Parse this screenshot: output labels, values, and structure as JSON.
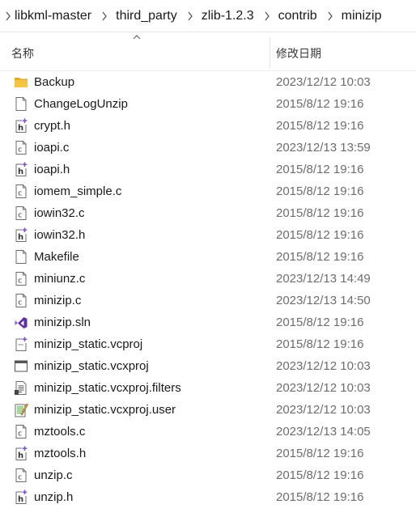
{
  "breadcrumb": [
    "libkml-master",
    "third_party",
    "zlib-1.2.3",
    "contrib",
    "minizip"
  ],
  "header": {
    "name_label": "名称",
    "date_label": "修改日期"
  },
  "files": [
    {
      "name": "Backup",
      "date": "2023/12/12 10:03",
      "icon": "folder-icon"
    },
    {
      "name": "ChangeLogUnzip",
      "date": "2015/8/12 19:16",
      "icon": "file-icon"
    },
    {
      "name": "crypt.h",
      "date": "2015/8/12 19:16",
      "icon": "header-file-icon"
    },
    {
      "name": "ioapi.c",
      "date": "2023/12/13 13:59",
      "icon": "c-file-icon"
    },
    {
      "name": "ioapi.h",
      "date": "2015/8/12 19:16",
      "icon": "header-file-icon"
    },
    {
      "name": "iomem_simple.c",
      "date": "2015/8/12 19:16",
      "icon": "c-file-icon"
    },
    {
      "name": "iowin32.c",
      "date": "2015/8/12 19:16",
      "icon": "c-file-icon"
    },
    {
      "name": "iowin32.h",
      "date": "2015/8/12 19:16",
      "icon": "header-file-icon"
    },
    {
      "name": "Makefile",
      "date": "2015/8/12 19:16",
      "icon": "file-icon"
    },
    {
      "name": "miniunz.c",
      "date": "2023/12/13 14:49",
      "icon": "c-file-icon"
    },
    {
      "name": "minizip.c",
      "date": "2023/12/13 14:50",
      "icon": "c-file-icon"
    },
    {
      "name": "minizip.sln",
      "date": "2015/8/12 19:16",
      "icon": "vs-solution-icon"
    },
    {
      "name": "minizip_static.vcproj",
      "date": "2015/8/12 19:16",
      "icon": "vcproj-icon"
    },
    {
      "name": "minizip_static.vcxproj",
      "date": "2023/12/12 10:03",
      "icon": "vcxproj-icon"
    },
    {
      "name": "minizip_static.vcxproj.filters",
      "date": "2023/12/12 10:03",
      "icon": "filters-file-icon"
    },
    {
      "name": "minizip_static.vcxproj.user",
      "date": "2023/12/12 10:03",
      "icon": "user-file-icon"
    },
    {
      "name": "mztools.c",
      "date": "2023/12/13 14:05",
      "icon": "c-file-icon"
    },
    {
      "name": "mztools.h",
      "date": "2015/8/12 19:16",
      "icon": "header-file-icon"
    },
    {
      "name": "unzip.c",
      "date": "2015/8/12 19:16",
      "icon": "c-file-icon"
    },
    {
      "name": "unzip.h",
      "date": "2015/8/12 19:16",
      "icon": "header-file-icon"
    }
  ],
  "colors": {
    "folder": "#f5c443",
    "accent": "#7c4dd6",
    "date_text": "#6d6d6d"
  }
}
